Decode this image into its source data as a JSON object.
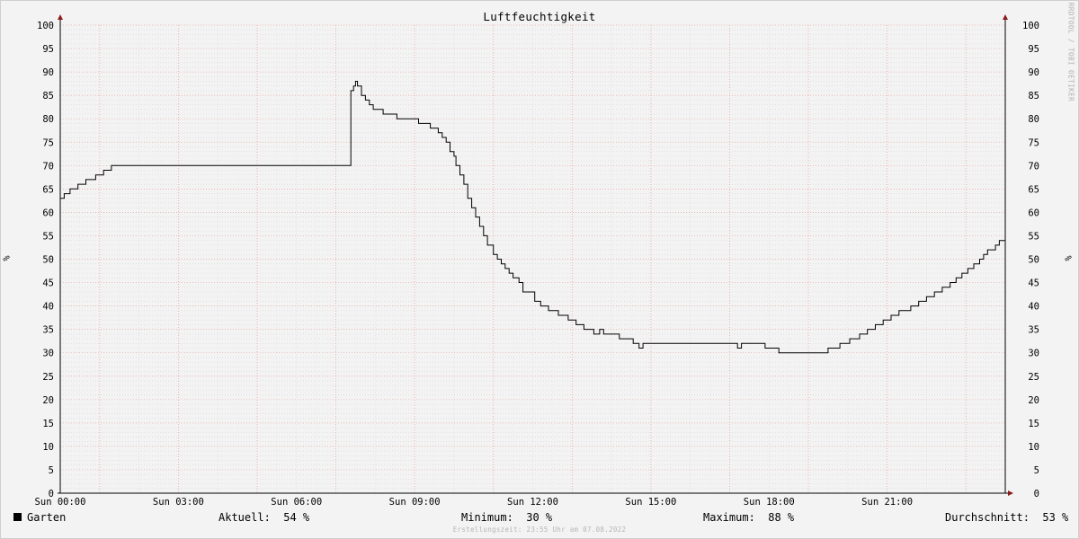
{
  "chart_data": {
    "type": "line",
    "title": "Luftfeuchtigkeit",
    "ylabel": "%",
    "ylim": [
      0,
      100
    ],
    "yticks": [
      0,
      5,
      10,
      15,
      20,
      25,
      30,
      35,
      40,
      45,
      50,
      55,
      60,
      65,
      70,
      75,
      80,
      85,
      90,
      95,
      100
    ],
    "xlim_hours": [
      0,
      24
    ],
    "xtick_labels": [
      {
        "hour": 0,
        "label": "Sun 00:00"
      },
      {
        "hour": 3,
        "label": "Sun 03:00"
      },
      {
        "hour": 6,
        "label": "Sun 06:00"
      },
      {
        "hour": 9,
        "label": "Sun 09:00"
      },
      {
        "hour": 12,
        "label": "Sun 12:00"
      },
      {
        "hour": 15,
        "label": "Sun 15:00"
      },
      {
        "hour": 18,
        "label": "Sun 18:00"
      },
      {
        "hour": 21,
        "label": "Sun 21:00"
      }
    ],
    "grid": true,
    "series": [
      {
        "name": "Garten",
        "color": "#000000",
        "points": [
          [
            0.0,
            63
          ],
          [
            0.1,
            64
          ],
          [
            0.25,
            65
          ],
          [
            0.45,
            66
          ],
          [
            0.65,
            67
          ],
          [
            0.9,
            68
          ],
          [
            1.1,
            69
          ],
          [
            1.3,
            70
          ],
          [
            7.35,
            70
          ],
          [
            7.38,
            86
          ],
          [
            7.45,
            87
          ],
          [
            7.5,
            88
          ],
          [
            7.55,
            87
          ],
          [
            7.65,
            85
          ],
          [
            7.75,
            84
          ],
          [
            7.85,
            83
          ],
          [
            7.95,
            82
          ],
          [
            8.2,
            81
          ],
          [
            8.55,
            80
          ],
          [
            9.0,
            80
          ],
          [
            9.1,
            79
          ],
          [
            9.4,
            78
          ],
          [
            9.6,
            77
          ],
          [
            9.7,
            76
          ],
          [
            9.8,
            75
          ],
          [
            9.9,
            73
          ],
          [
            10.0,
            72
          ],
          [
            10.05,
            70
          ],
          [
            10.15,
            68
          ],
          [
            10.25,
            66
          ],
          [
            10.35,
            63
          ],
          [
            10.45,
            61
          ],
          [
            10.55,
            59
          ],
          [
            10.65,
            57
          ],
          [
            10.75,
            55
          ],
          [
            10.85,
            53
          ],
          [
            11.0,
            51
          ],
          [
            11.1,
            50
          ],
          [
            11.2,
            49
          ],
          [
            11.3,
            48
          ],
          [
            11.4,
            47
          ],
          [
            11.5,
            46
          ],
          [
            11.65,
            45
          ],
          [
            11.75,
            43
          ],
          [
            11.95,
            43
          ],
          [
            12.05,
            41
          ],
          [
            12.2,
            40
          ],
          [
            12.4,
            39
          ],
          [
            12.65,
            38
          ],
          [
            12.9,
            37
          ],
          [
            13.1,
            36
          ],
          [
            13.3,
            35
          ],
          [
            13.55,
            34
          ],
          [
            13.7,
            35
          ],
          [
            13.8,
            34
          ],
          [
            14.1,
            34
          ],
          [
            14.2,
            33
          ],
          [
            14.55,
            32
          ],
          [
            14.7,
            31
          ],
          [
            14.8,
            32
          ],
          [
            17.1,
            32
          ],
          [
            17.2,
            31
          ],
          [
            17.3,
            32
          ],
          [
            17.85,
            32
          ],
          [
            17.9,
            31
          ],
          [
            18.2,
            31
          ],
          [
            18.25,
            30
          ],
          [
            19.45,
            30
          ],
          [
            19.5,
            31
          ],
          [
            19.8,
            32
          ],
          [
            20.05,
            33
          ],
          [
            20.3,
            34
          ],
          [
            20.5,
            35
          ],
          [
            20.7,
            36
          ],
          [
            20.9,
            37
          ],
          [
            21.1,
            38
          ],
          [
            21.3,
            39
          ],
          [
            21.6,
            40
          ],
          [
            21.8,
            41
          ],
          [
            22.0,
            42
          ],
          [
            22.2,
            43
          ],
          [
            22.4,
            44
          ],
          [
            22.6,
            45
          ],
          [
            22.75,
            46
          ],
          [
            22.9,
            47
          ],
          [
            23.05,
            48
          ],
          [
            23.2,
            49
          ],
          [
            23.35,
            50
          ],
          [
            23.45,
            51
          ],
          [
            23.55,
            52
          ],
          [
            23.75,
            53
          ],
          [
            23.85,
            54
          ],
          [
            24.0,
            54
          ]
        ]
      }
    ]
  },
  "watermark": "RRDTOOL / TOBI OETIKER",
  "legend": {
    "series_name": "Garten",
    "aktuell": "Aktuell:  54 %",
    "minimum": "Minimum:  30 %",
    "maximum": "Maximum:  88 %",
    "durchschnitt": "Durchschnitt:  53 %"
  },
  "footer": "Erstellungszeit: 23:55 Uhr am 07.08.2022"
}
